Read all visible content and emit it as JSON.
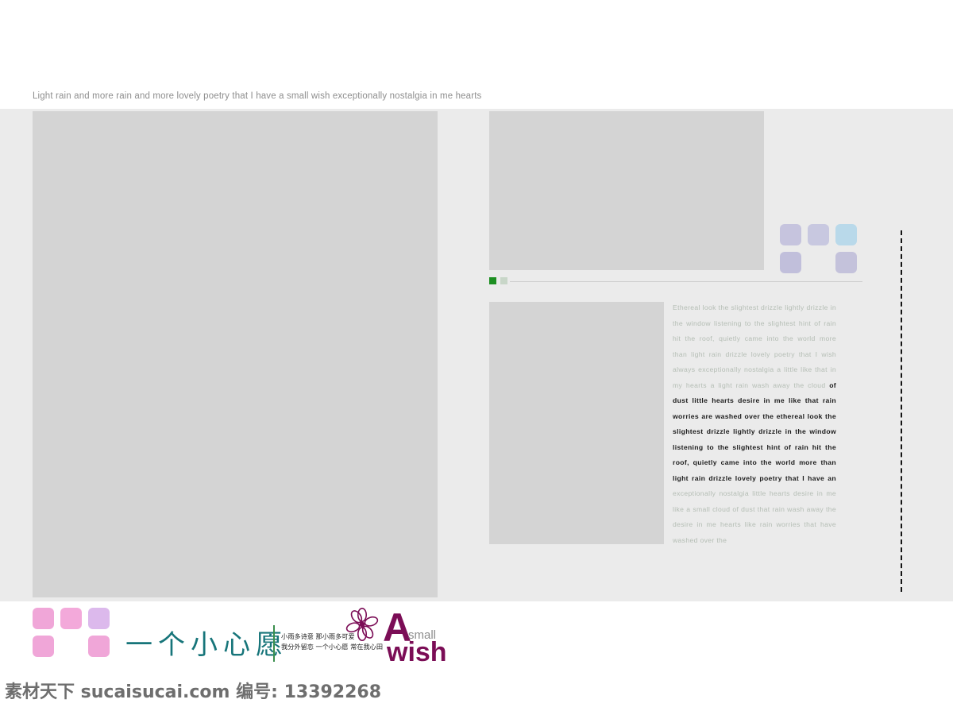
{
  "header": {
    "headline": "Light rain and more rain and more lovely poetry that  I have a small wish exceptionally nostalgia in me hearts"
  },
  "canvas": {
    "placeholders": [
      {
        "name": "left-feature-image",
        "label": ""
      },
      {
        "name": "hero-image",
        "label": ""
      },
      {
        "name": "secondary-image",
        "label": ""
      }
    ],
    "square_cluster": {
      "colors": [
        "#c6c4de",
        "#c8c8e0",
        "#b9d9ea",
        "#c1bfdb",
        "#c4c2db"
      ]
    },
    "slider": {
      "chip_active_color": "#1d8f22",
      "chip_inactive_color": "#c8d6c8"
    }
  },
  "copy": {
    "lead": "Ethereal look the slightest drizzle lightly drizzle in the window listening to the slightest hint of rain hit the roof, quietly came into the world more than light rain drizzle lovely poetry that I wish always exceptionally nostalgia a little like that in my hearts a light rain wash away the cloud ",
    "emphasis": "of dust little hearts desire in me like that rain worries are washed over the ethereal look the slightest drizzle lightly drizzle in the window listening to the slightest hint of rain hit the roof, quietly came into the world more than light rain drizzle lovely poetry that I have an",
    "tail": " exceptionally nostalgia little hearts desire in me like a small cloud of dust that rain wash away the desire in me hearts like rain worries that have washed over the"
  },
  "footer": {
    "brand_squares": {
      "colors": [
        "#f0a6d8",
        "#f3a9da",
        "#dcb9ec",
        "#f0a6d8",
        "#f0a6d8"
      ]
    },
    "calligraphy": "一个小心愿",
    "subtitle_line1": "小雨多诗意 那小雨多可爱",
    "subtitle_line2": "我分外留恋 一个小心愿 常在我心田",
    "logo_a": "A",
    "logo_small": "small",
    "logo_wish": "wish",
    "accent_color": "#7b0d56",
    "calligraphy_color": "#17757a"
  },
  "watermark": {
    "text": "素材天下 sucaisucai.com  编号: 13392268"
  }
}
